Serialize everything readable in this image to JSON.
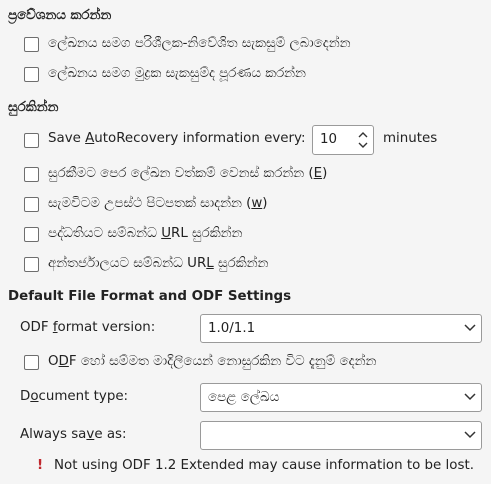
{
  "load": {
    "heading": "ප්‍රවේශනය කරන්න",
    "load_user_settings": "ලේඛනය සමග පරිශීලක-නිවේශිත සැකසුම් ලබාදෙන්න",
    "load_printer_settings": "ලේඛනය සමග මුද්‍රක සැකසුම්ද පූරණය කරන්න"
  },
  "save": {
    "heading": "සුරකින්න",
    "autorecovery_pre": "Save ",
    "autorecovery_key": "A",
    "autorecovery_post": "utoRecovery information every:",
    "autorecovery_value": "10",
    "autorecovery_unit": "minutes",
    "edit_props_pre": "සුරකීමට පෙර ලේඛන වත්කම් වෙනස් කරන්න (",
    "edit_props_key": "E",
    "edit_props_post": ")",
    "backup_pre": "සැමවිටම උපස්ථ පිටපතක් සාදන්න (",
    "backup_key": "w",
    "backup_post": ")",
    "rel_fs_pre": "පද්ධතියට සම්බන්ධ ",
    "rel_fs_key": "U",
    "rel_fs_post": "RL සුරකින්න",
    "rel_inet_pre": "අන්තර්ජාලයට සම්බන්ධ UR",
    "rel_inet_key": "L",
    "rel_inet_post": " සුරකින්න"
  },
  "format": {
    "heading": "Default File Format and ODF Settings",
    "odf_version_pre": "ODF ",
    "odf_version_key": "f",
    "odf_version_post": "ormat version:",
    "odf_version_value": "1.0/1.1",
    "warn_non_odf_pre": "O",
    "warn_non_odf_key": "D",
    "warn_non_odf_post": "F හෝ සම්මත මාදිලියෙන් නොසුරකින විට දැනුම් දෙන්න",
    "doc_type_pre": "D",
    "doc_type_key": "o",
    "doc_type_post": "cument type:",
    "doc_type_value": "පෙළ ලේඛය",
    "always_save_pre": "Always sa",
    "always_save_key": "v",
    "always_save_post": "e as:",
    "always_save_value": "",
    "warning_icon": "!",
    "warning_text": "Not using ODF 1.2 Extended may cause information to be lost."
  },
  "colors": {
    "warning": "#c0282e"
  }
}
